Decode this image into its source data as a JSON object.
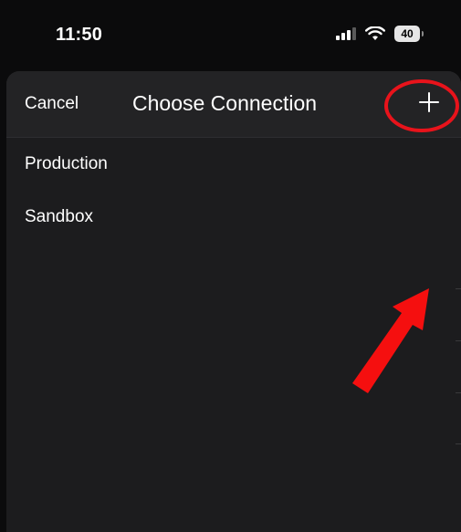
{
  "status_bar": {
    "time": "11:50",
    "battery_level": "40",
    "icons": [
      "signal-icon",
      "wifi-icon",
      "battery-icon"
    ]
  },
  "nav": {
    "cancel_label": "Cancel",
    "title": "Choose Connection",
    "add_icon": "plus-icon"
  },
  "connections": [
    {
      "label": "Production"
    },
    {
      "label": "Sandbox"
    }
  ],
  "annotations": {
    "circle_color": "#e8131b",
    "arrow_color": "#f50f0f"
  },
  "colors": {
    "background": "#0b0b0c",
    "sheet": "#1c1c1e",
    "nav_bar": "#232325",
    "text": "#ffffff"
  }
}
